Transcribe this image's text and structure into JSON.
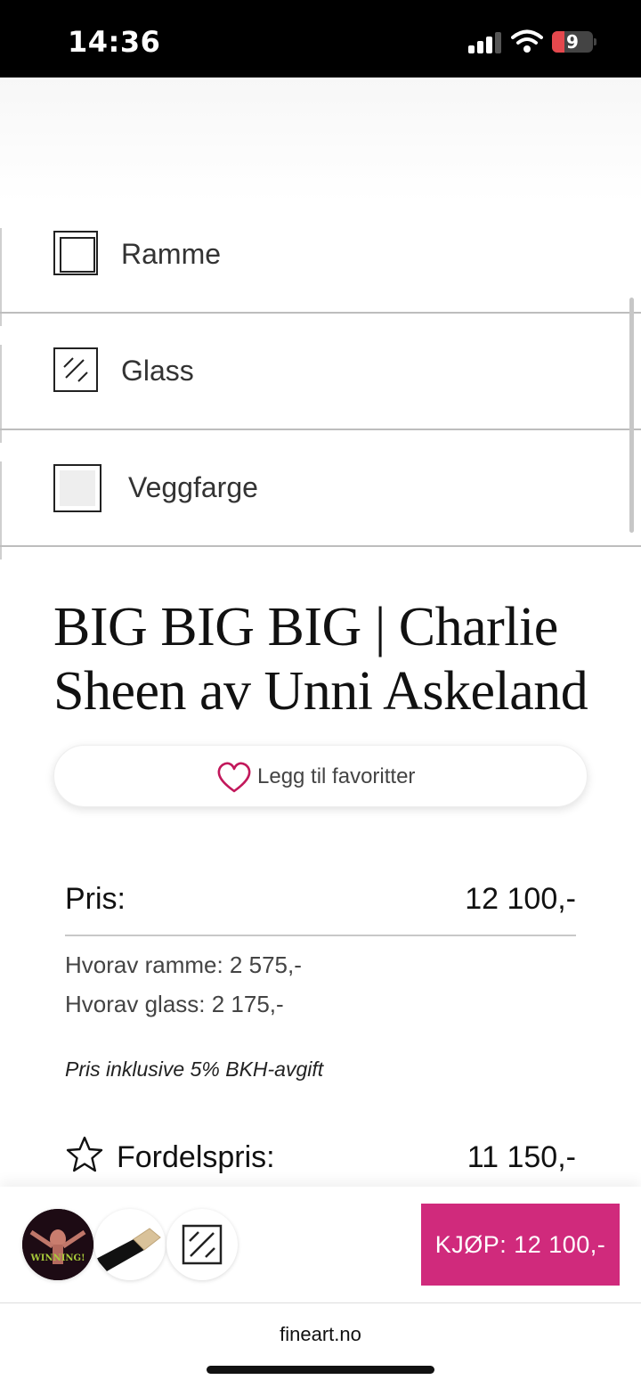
{
  "status_bar": {
    "time": "14:36",
    "battery": "9"
  },
  "options": [
    {
      "label": "Ramme",
      "icon": "frame-icon"
    },
    {
      "label": "Glass",
      "icon": "glass-icon"
    },
    {
      "label": "Veggfarge",
      "icon": "wall-color-swatch-icon"
    }
  ],
  "product": {
    "title": "BIG BIG BIG | Charlie Sheen av Unni Askeland"
  },
  "favorite": {
    "label": "Legg til favoritter",
    "icon": "heart-icon",
    "color": "#c2185b"
  },
  "pricing": {
    "price_label": "Pris:",
    "price_value": "12 100,-",
    "frame_part": "Hvorav ramme: 2 575,-",
    "glass_part": "Hvorav glass: 2 175,-",
    "tax_note": "Pris inklusive 5% BKH-avgift",
    "member_label": "Fordelspris:",
    "member_value": "11 150,-"
  },
  "bottom_bar": {
    "thumbnail_text": "WINNING!",
    "buy_label": "KJØP: 12 100,-",
    "buy_color": "#d02a7c"
  },
  "browser": {
    "url": "fineart.no"
  }
}
